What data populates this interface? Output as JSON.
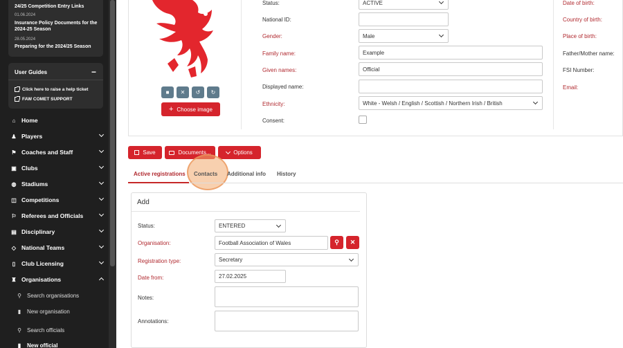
{
  "sidebar": {
    "news": [
      {
        "title": "24/25 Competition Entry Links"
      },
      {
        "date": "01.06.2024",
        "title": "Insurance Policy Documents for the 2024-25 Season"
      },
      {
        "date": "28.05.2024",
        "title": "Preparing for the 2024/25 Season"
      }
    ],
    "user_guides": {
      "title": "User Guides",
      "collapse": "−",
      "links": [
        "Click here to raise a help ticket",
        "FAW COMET SUPPORT"
      ]
    },
    "nav": [
      {
        "label": "Home",
        "icon": "home-icon",
        "glyph": "⌂"
      },
      {
        "label": "Players",
        "icon": "players-icon",
        "glyph": "♟"
      },
      {
        "label": "Coaches and Staff",
        "icon": "coach-icon",
        "glyph": "⚑"
      },
      {
        "label": "Clubs",
        "icon": "clubs-icon",
        "glyph": "▣"
      },
      {
        "label": "Stadiums",
        "icon": "stadium-icon",
        "glyph": "◍"
      },
      {
        "label": "Competitions",
        "icon": "competition-icon",
        "glyph": "◫"
      },
      {
        "label": "Referees and Officials",
        "icon": "referee-icon",
        "glyph": "⚐"
      },
      {
        "label": "Disciplinary",
        "icon": "disciplinary-icon",
        "glyph": "▤"
      },
      {
        "label": "National Teams",
        "icon": "tag-icon",
        "glyph": "◇"
      },
      {
        "label": "Club Licensing",
        "icon": "bookmark-icon",
        "glyph": "▯"
      },
      {
        "label": "Organisations",
        "icon": "organisations-icon",
        "glyph": "♜"
      }
    ],
    "sub_nav": [
      {
        "label": "Search organisations",
        "icon": "search-icon",
        "glyph": "⚲"
      },
      {
        "label": "New organisation",
        "icon": "new-document-icon",
        "glyph": "▮"
      },
      {
        "label": "Search officials",
        "icon": "search-icon",
        "glyph": "⚲"
      },
      {
        "label": "New official",
        "icon": "new-document-icon",
        "glyph": "▮"
      }
    ]
  },
  "photo": {
    "choose_image_label": "Choose image",
    "buttons": [
      "camera-icon",
      "remove-icon",
      "undo-icon",
      "redo-icon"
    ]
  },
  "form": {
    "status": {
      "label": "Status:",
      "value": "ACTIVE"
    },
    "national_id": {
      "label": "National ID:",
      "value": ""
    },
    "gender": {
      "label": "Gender:",
      "value": "Male"
    },
    "family_name": {
      "label": "Family name:",
      "value": "Example"
    },
    "given_names": {
      "label": "Given names:",
      "value": "Official"
    },
    "displayed_name": {
      "label": "Displayed name:",
      "value": ""
    },
    "ethnicity": {
      "label": "Ethnicity:",
      "value": "White - Welsh / English / Scottish / Northern Irish / British"
    },
    "consent": {
      "label": "Consent:"
    }
  },
  "right_labels": {
    "date_of_birth": "Date of birth:",
    "country_of_birth": "Country of birth:",
    "place_of_birth": "Place of birth:",
    "father_mother_name": "Father/Mother name:",
    "fsi_number": "FSI Number:",
    "email": "Email:"
  },
  "actions": {
    "save": "Save",
    "documents": "Documents...",
    "options": "Options"
  },
  "tabs": [
    "Active registrations",
    "Contacts",
    "Additional info",
    "History"
  ],
  "add_panel": {
    "title": "Add",
    "status": {
      "label": "Status:",
      "value": "ENTERED"
    },
    "organisation": {
      "label": "Organisation:",
      "value": "Football Association of Wales"
    },
    "registration_type": {
      "label": "Registration type:",
      "value": "Secretary"
    },
    "date_from": {
      "label": "Date from:",
      "value": "27.02.2025"
    },
    "notes": {
      "label": "Notes:",
      "value": ""
    },
    "annotations": {
      "label": "Annotations:",
      "value": ""
    }
  },
  "colors": {
    "accent": "#d5242c",
    "sidebar_bg": "#1f1f1f",
    "required_label": "#b0282e",
    "highlight": "#f3aa6e"
  }
}
